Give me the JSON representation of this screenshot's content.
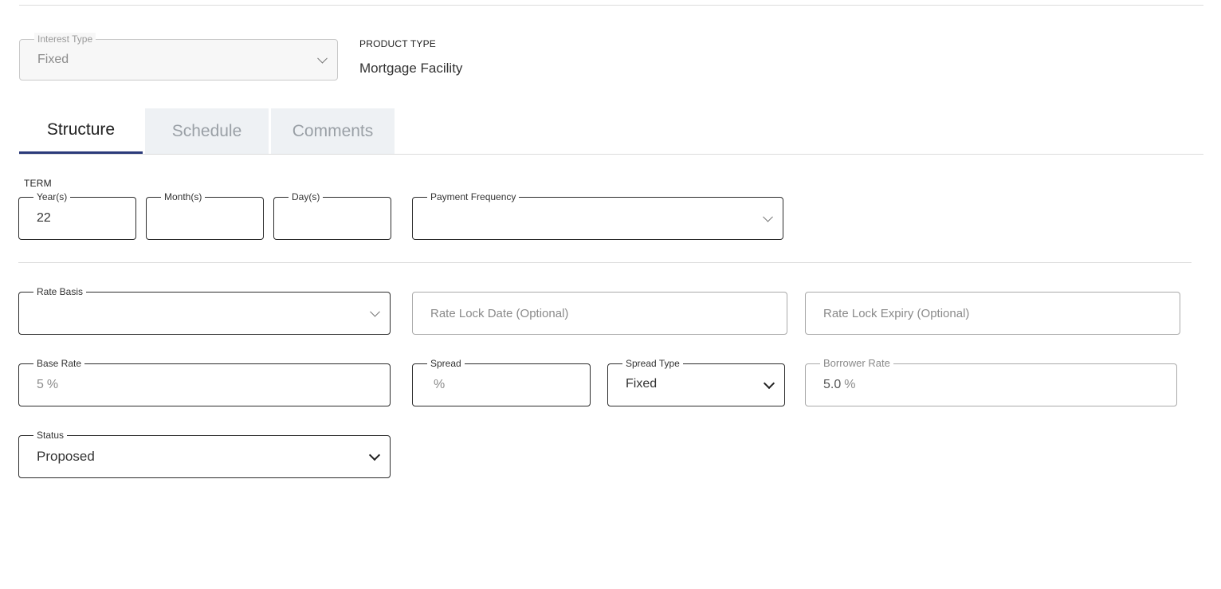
{
  "interest_type": {
    "label": "Interest Type",
    "value": "Fixed"
  },
  "product_type": {
    "label": "PRODUCT TYPE",
    "value": "Mortgage Facility"
  },
  "tabs": [
    {
      "label": "Structure",
      "active": true
    },
    {
      "label": "Schedule",
      "active": false
    },
    {
      "label": "Comments",
      "active": false
    }
  ],
  "term": {
    "label": "TERM",
    "years": {
      "label": "Year(s)",
      "value": "22"
    },
    "months": {
      "label": "Month(s)",
      "value": ""
    },
    "days": {
      "label": "Day(s)",
      "value": ""
    }
  },
  "payment_frequency": {
    "label": "Payment Frequency",
    "value": ""
  },
  "rate_basis": {
    "label": "Rate Basis",
    "value": ""
  },
  "rate_lock_date": {
    "placeholder": "Rate Lock Date (Optional)"
  },
  "rate_lock_expiry": {
    "placeholder": "Rate Lock Expiry (Optional)"
  },
  "base_rate": {
    "label": "Base Rate",
    "value": "5",
    "unit": "%"
  },
  "spread": {
    "label": "Spread",
    "value": "",
    "unit": "%"
  },
  "spread_type": {
    "label": "Spread Type",
    "value": "Fixed"
  },
  "borrower_rate": {
    "label": "Borrower Rate",
    "value": "5.0",
    "unit": "%"
  },
  "status": {
    "label": "Status",
    "value": "Proposed"
  },
  "colors": {
    "active_tab_underline": "#2b3a7a",
    "tab_inactive_bg": "#eef1f4"
  },
  "icons": {
    "dropdown": "chevron-down-icon"
  }
}
